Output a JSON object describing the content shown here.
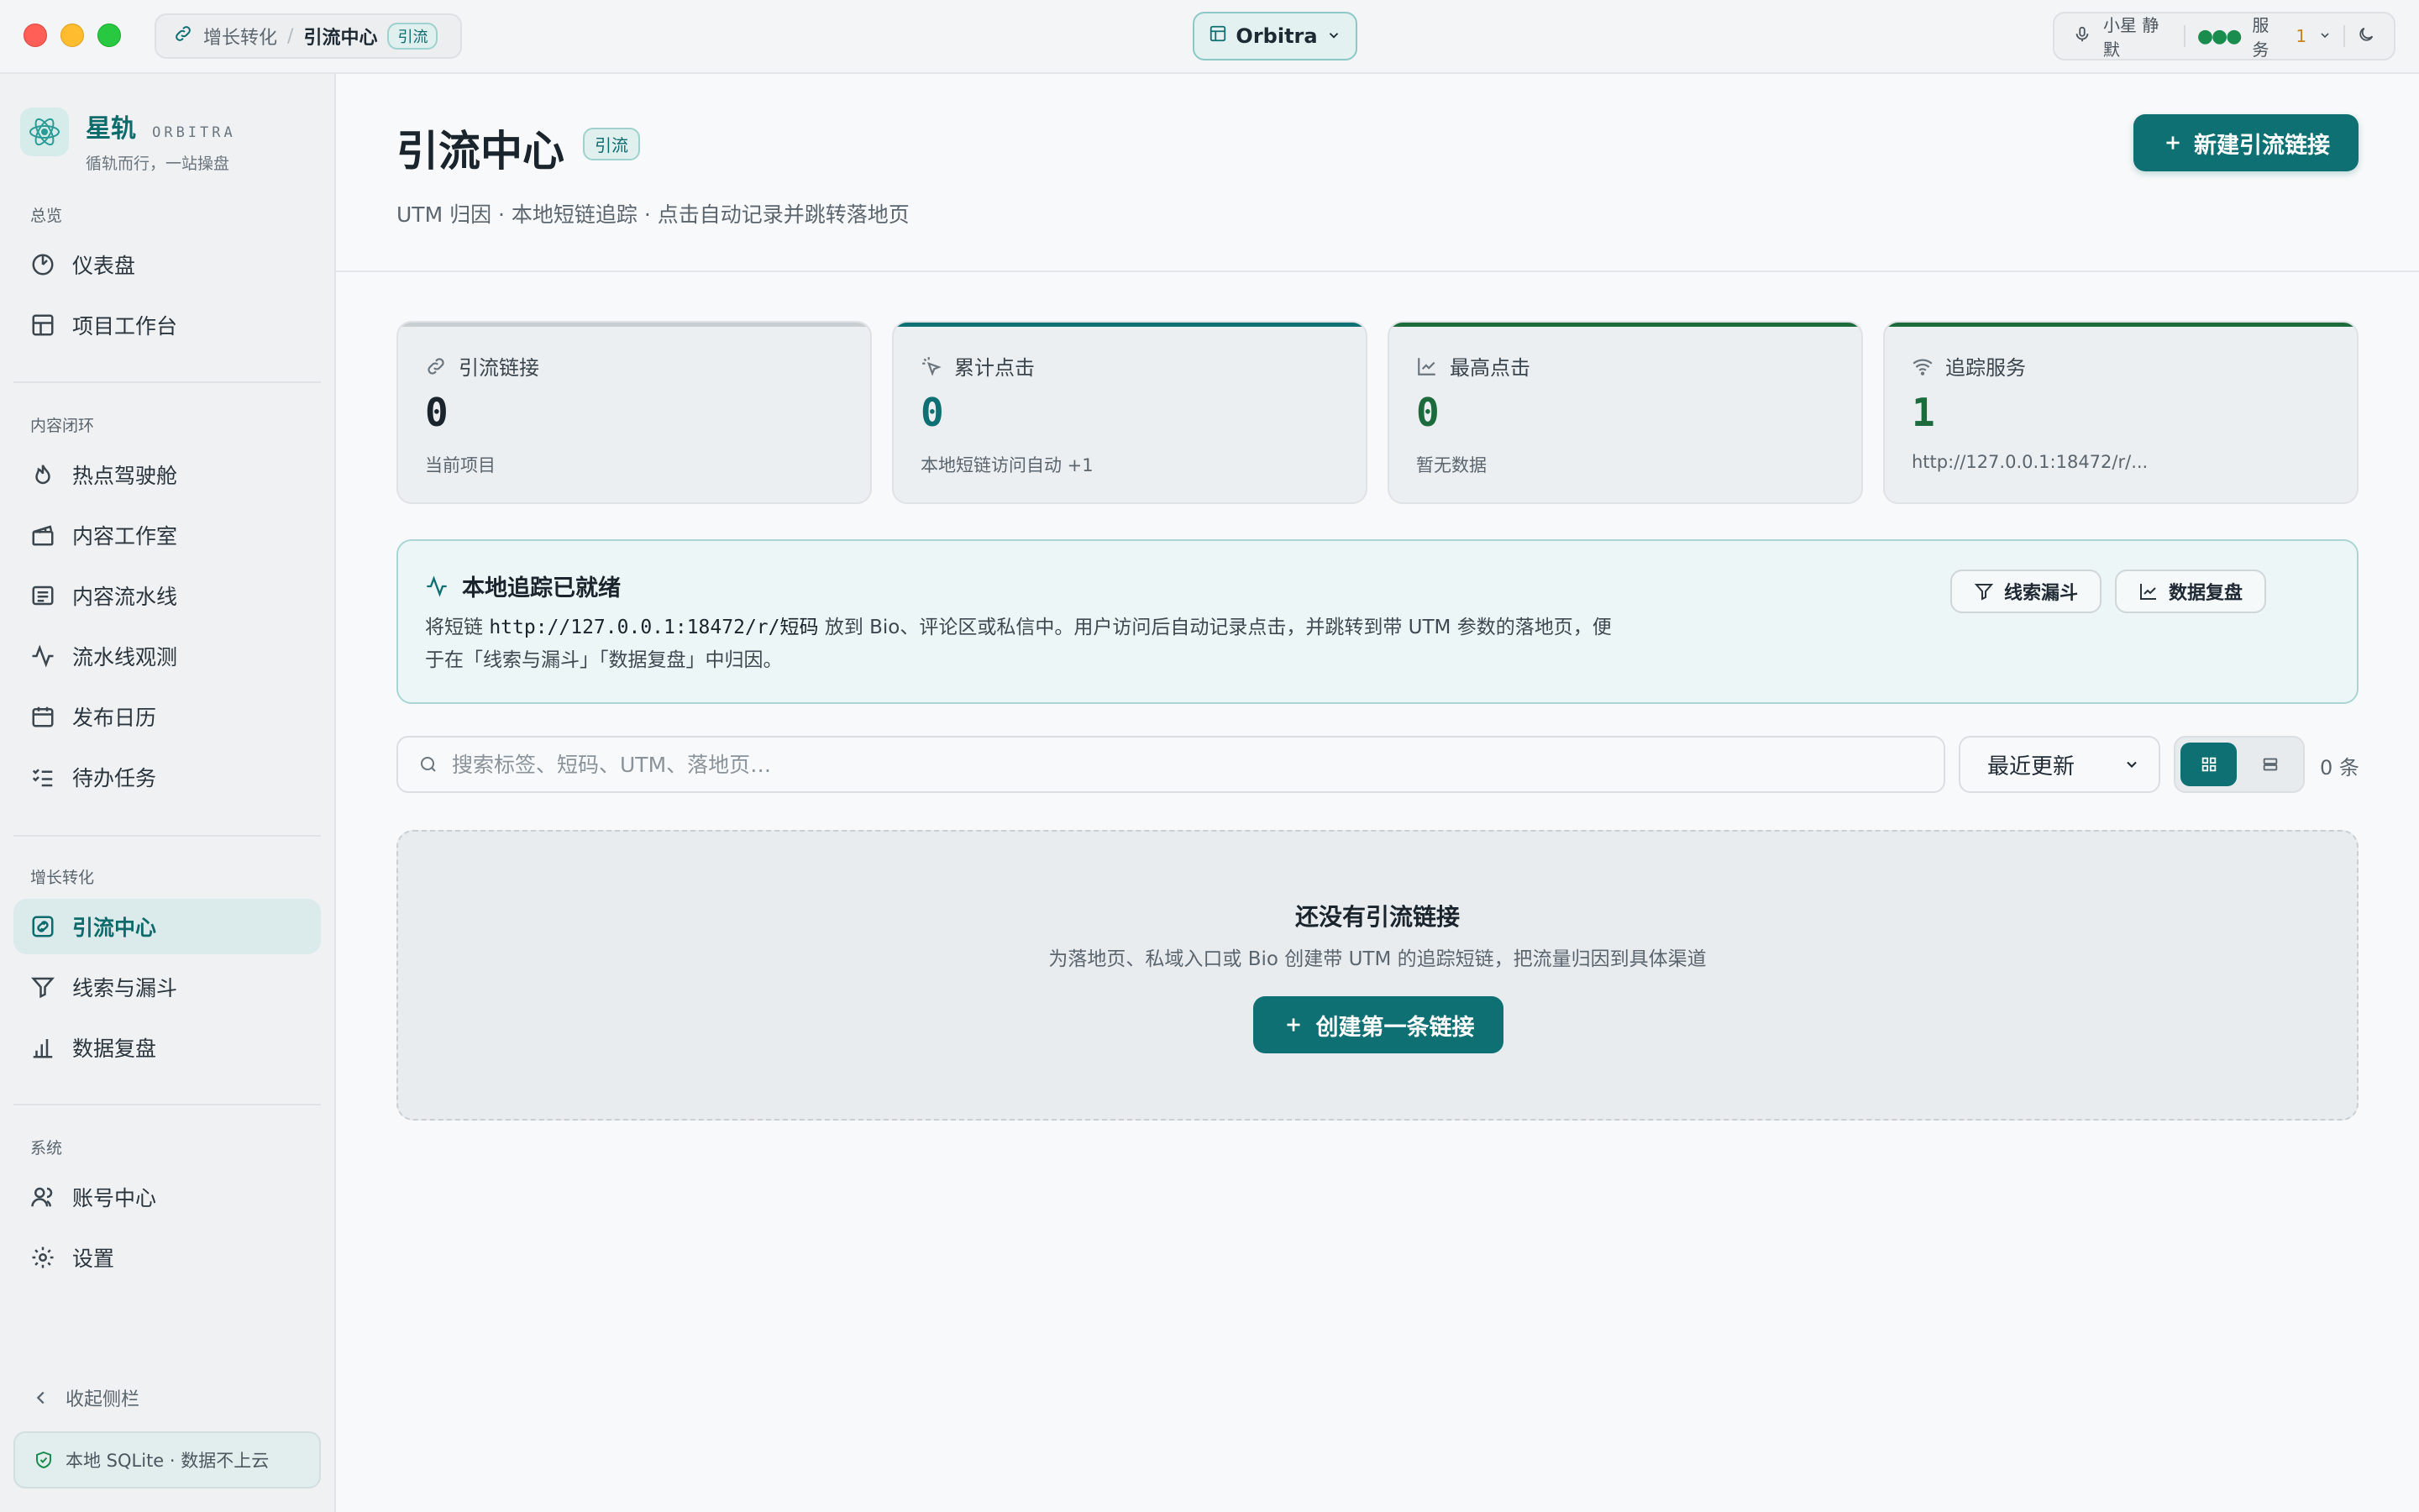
{
  "titlebar": {
    "breadcrumb_parent": "增长转化",
    "breadcrumb_current": "引流中心",
    "breadcrumb_tag": "引流",
    "workspace": "Orbitra",
    "voice_status": "小星 静默",
    "service_label": "服务",
    "service_count": "1"
  },
  "brand": {
    "name": "星轨",
    "sub": "ORBITRA",
    "slogan": "循轨而行，一站操盘"
  },
  "sidebar": {
    "sections": [
      "总览",
      "内容闭环",
      "增长转化",
      "系统"
    ],
    "items": [
      {
        "label": "仪表盘",
        "icon": "gauge-icon"
      },
      {
        "label": "项目工作台",
        "icon": "layout-icon"
      },
      {
        "label": "热点驾驶舱",
        "icon": "flame-icon"
      },
      {
        "label": "内容工作室",
        "icon": "clapper-icon"
      },
      {
        "label": "内容流水线",
        "icon": "list-icon"
      },
      {
        "label": "流水线观测",
        "icon": "activity-icon"
      },
      {
        "label": "发布日历",
        "icon": "calendar-icon"
      },
      {
        "label": "待办任务",
        "icon": "checklist-icon"
      },
      {
        "label": "引流中心",
        "icon": "link-icon",
        "active": true
      },
      {
        "label": "线索与漏斗",
        "icon": "funnel-icon"
      },
      {
        "label": "数据复盘",
        "icon": "bar-chart-icon"
      },
      {
        "label": "账号中心",
        "icon": "users-icon"
      },
      {
        "label": "设置",
        "icon": "gear-icon"
      }
    ],
    "collapse_label": "收起侧栏",
    "local_badge": "本地 SQLite · 数据不上云"
  },
  "page": {
    "title": "引流中心",
    "tag": "引流",
    "subtitle": "UTM 归因 · 本地短链追踪 · 点击自动记录并跳转落地页",
    "new_button": "新建引流链接"
  },
  "stats": [
    {
      "label": "引流链接",
      "value": "0",
      "note": "当前项目",
      "color": "#1a242c",
      "bar": "#c9ced2"
    },
    {
      "label": "累计点击",
      "value": "0",
      "note": "本地短链访问自动 +1",
      "color": "#0e7072",
      "bar": "#0e7072"
    },
    {
      "label": "最高点击",
      "value": "0",
      "note": "暂无数据",
      "color": "#1c6b3c",
      "bar": "#1c6b3c"
    },
    {
      "label": "追踪服务",
      "value": "1",
      "note": "http://127.0.0.1:18472/r/...",
      "color": "#1c6b3c",
      "bar": "#1c6b3c"
    }
  ],
  "info": {
    "title": "本地追踪已就绪",
    "desc_pre": "将短链",
    "desc_code": "http://127.0.0.1:18472/r/短码",
    "desc_post": "放到 Bio、评论区或私信中。用户访问后自动记录点击，并跳转到带 UTM 参数的落地页，便于在「线索与漏斗」「数据复盘」中归因。",
    "btn_funnel": "线索漏斗",
    "btn_review": "数据复盘"
  },
  "toolbar": {
    "search_placeholder": "搜索标签、短码、UTM、落地页…",
    "search_value": "",
    "sort_selected": "最近更新",
    "count": "0 条"
  },
  "empty": {
    "title": "还没有引流链接",
    "desc": "为落地页、私域入口或 Bio 创建带 UTM 的追踪短链，把流量归因到具体渠道",
    "button": "创建第一条链接"
  }
}
